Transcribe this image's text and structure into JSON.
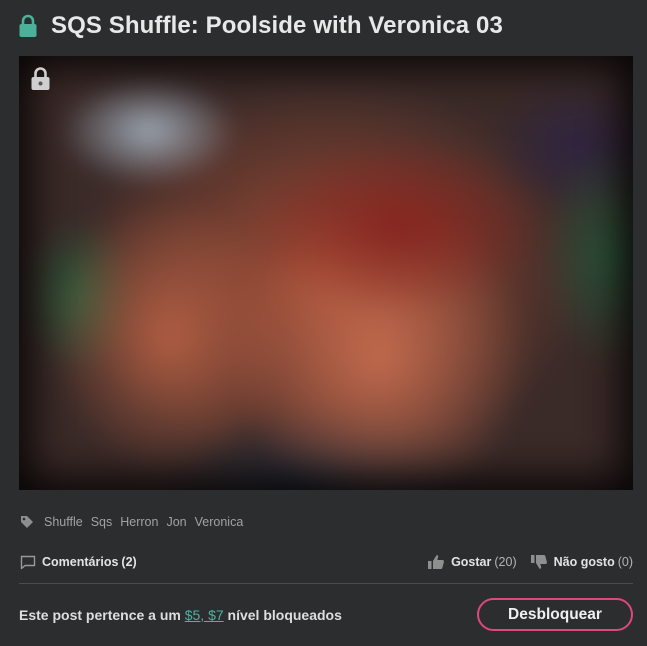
{
  "post": {
    "title": "SQS Shuffle: Poolside with Veronica 03"
  },
  "tags": [
    "Shuffle",
    "Sqs",
    "Herron",
    "Jon",
    "Veronica"
  ],
  "actions": {
    "comments_label": "Comentários",
    "comments_count": "(2)",
    "like_label": "Gostar",
    "like_count": "(20)",
    "dislike_label": "Não gosto",
    "dislike_count": "(0)"
  },
  "footer": {
    "note_prefix": "Este post pertence a um",
    "tier_link": "$5, $7",
    "note_suffix": "nível bloqueados",
    "unlock_label": "Desbloquear"
  },
  "icons": {
    "title_lock": "lock-icon",
    "preview_lock": "lock-icon",
    "tag": "tag-icon",
    "comment": "comment-icon",
    "like": "thumbs-up-icon",
    "dislike": "thumbs-down-icon"
  },
  "colors": {
    "background": "#2b2d2e",
    "accent_lock": "#4bb19a",
    "accent_link": "#4fb2a2",
    "unlock_border": "#e0477d"
  }
}
